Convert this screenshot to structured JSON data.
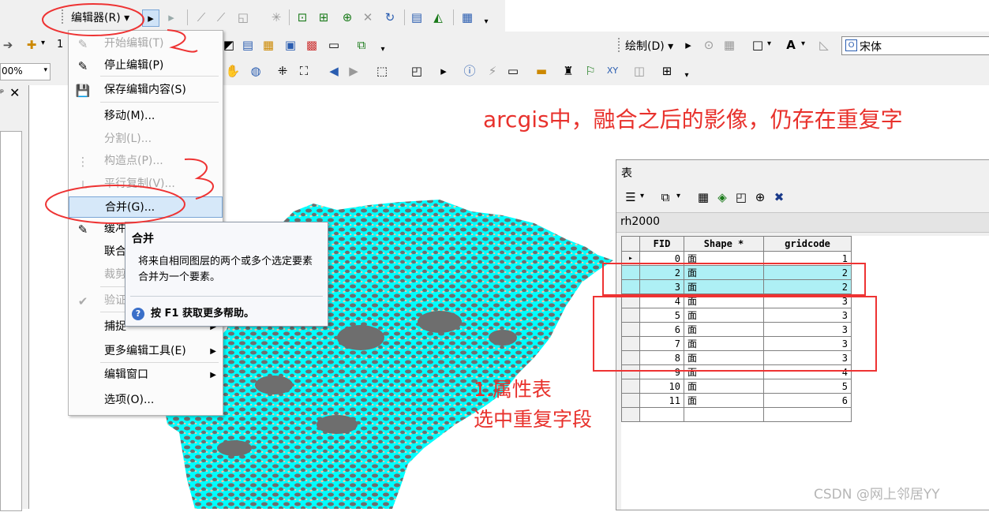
{
  "toolbar1": {
    "editor_label": "编辑器(R)"
  },
  "toolbar2": {
    "left_num": "1",
    "draw_label": "绘制(D)",
    "font_name": "宋体",
    "font_letter": "A"
  },
  "toolbar3": {
    "zoom": "00%"
  },
  "menu": {
    "items": [
      {
        "label": "开始编辑(T)",
        "icon": "pencil-icon",
        "enabled": false
      },
      {
        "label": "停止编辑(P)",
        "icon": "stop-pencil-icon",
        "enabled": true
      },
      {
        "label": "保存编辑内容(S)",
        "icon": "save-icon",
        "enabled": true
      },
      {
        "label": "移动(M)...",
        "enabled": true
      },
      {
        "label": "分割(L)...",
        "enabled": false
      },
      {
        "label": "构造点(P)...",
        "icon": "construct-points-icon",
        "enabled": false
      },
      {
        "label": "平行复制(V)...",
        "icon": "copy-parallel-icon",
        "enabled": false
      },
      {
        "label": "合并(G)...",
        "enabled": true,
        "highlighted": true
      },
      {
        "label": "缓冲",
        "icon": "buffer-icon",
        "enabled": true
      },
      {
        "label": "联合",
        "enabled": true
      },
      {
        "label": "裁剪",
        "enabled": false
      },
      {
        "label": "验证",
        "icon": "validate-icon",
        "enabled": false
      },
      {
        "label": "捕捉",
        "enabled": true,
        "submenu": true
      },
      {
        "label": "更多编辑工具(E)",
        "enabled": true,
        "submenu": true
      },
      {
        "label": "编辑窗口",
        "enabled": true,
        "submenu": true
      },
      {
        "label": "选项(O)...",
        "enabled": true
      }
    ]
  },
  "tooltip": {
    "title": "合并",
    "body": "将来自相同图层的两个或多个选定要素合并为一个要素。",
    "help": "按 F1 获取更多帮助。"
  },
  "table_window": {
    "title": "表",
    "layer_tab": "rh2000",
    "columns": [
      "FID",
      "Shape *",
      "gridcode"
    ],
    "rows": [
      {
        "fid": "0",
        "shape": "面",
        "gridcode": "1",
        "current": true
      },
      {
        "fid": "2",
        "shape": "面",
        "gridcode": "2",
        "selected": true
      },
      {
        "fid": "3",
        "shape": "面",
        "gridcode": "2",
        "selected": true
      },
      {
        "fid": "4",
        "shape": "面",
        "gridcode": "3"
      },
      {
        "fid": "5",
        "shape": "面",
        "gridcode": "3"
      },
      {
        "fid": "6",
        "shape": "面",
        "gridcode": "3"
      },
      {
        "fid": "7",
        "shape": "面",
        "gridcode": "3"
      },
      {
        "fid": "8",
        "shape": "面",
        "gridcode": "3"
      },
      {
        "fid": "9",
        "shape": "面",
        "gridcode": "4"
      },
      {
        "fid": "10",
        "shape": "面",
        "gridcode": "5"
      },
      {
        "fid": "11",
        "shape": "面",
        "gridcode": "6"
      }
    ]
  },
  "annotations": {
    "heading": "arcgis中，融合之后的影像，仍存在重复字",
    "step_line1": "1.属性表",
    "step_line2": "选中重复字段"
  },
  "watermark": "CSDN @网上邻居YY",
  "colors": {
    "map_fill": "#00ffff",
    "map_dark": "#6e6e6e",
    "map_tan": "#f2c9a6",
    "annotation": "#e8312c",
    "selection": "#aef0f5"
  }
}
